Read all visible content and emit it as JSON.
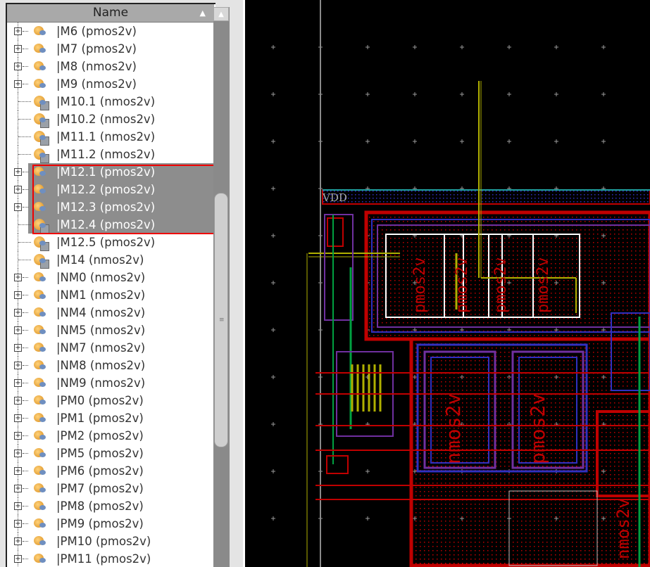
{
  "tree": {
    "column_header": "Name",
    "sort_indicator": "ascending",
    "rows": [
      {
        "label": "|M6 (pmos2v)",
        "expandable": true,
        "selected": false
      },
      {
        "label": "|M7 (pmos2v)",
        "expandable": true,
        "selected": false
      },
      {
        "label": "|M8 (nmos2v)",
        "expandable": true,
        "selected": false
      },
      {
        "label": "|M9 (nmos2v)",
        "expandable": true,
        "selected": false
      },
      {
        "label": "|M10.1 (nmos2v)",
        "expandable": false,
        "selected": false
      },
      {
        "label": "|M10.2 (nmos2v)",
        "expandable": false,
        "selected": false
      },
      {
        "label": "|M11.1 (nmos2v)",
        "expandable": false,
        "selected": false
      },
      {
        "label": "|M11.2 (nmos2v)",
        "expandable": false,
        "selected": false
      },
      {
        "label": "|M12.1 (pmos2v)",
        "expandable": true,
        "selected": true
      },
      {
        "label": "|M12.2 (pmos2v)",
        "expandable": true,
        "selected": true
      },
      {
        "label": "|M12.3 (pmos2v)",
        "expandable": true,
        "selected": true
      },
      {
        "label": "|M12.4 (pmos2v)",
        "expandable": false,
        "selected": true
      },
      {
        "label": "|M12.5 (pmos2v)",
        "expandable": false,
        "selected": false
      },
      {
        "label": "|M14 (nmos2v)",
        "expandable": false,
        "selected": false
      },
      {
        "label": "|NM0 (nmos2v)",
        "expandable": true,
        "selected": false
      },
      {
        "label": "|NM1 (nmos2v)",
        "expandable": true,
        "selected": false
      },
      {
        "label": "|NM4 (nmos2v)",
        "expandable": true,
        "selected": false
      },
      {
        "label": "|NM5 (nmos2v)",
        "expandable": true,
        "selected": false
      },
      {
        "label": "|NM7 (nmos2v)",
        "expandable": true,
        "selected": false
      },
      {
        "label": "|NM8 (nmos2v)",
        "expandable": true,
        "selected": false
      },
      {
        "label": "|NM9 (nmos2v)",
        "expandable": true,
        "selected": false
      },
      {
        "label": "|PM0 (pmos2v)",
        "expandable": true,
        "selected": false
      },
      {
        "label": "|PM1 (pmos2v)",
        "expandable": true,
        "selected": false
      },
      {
        "label": "|PM2 (pmos2v)",
        "expandable": true,
        "selected": false
      },
      {
        "label": "|PM5 (pmos2v)",
        "expandable": true,
        "selected": false
      },
      {
        "label": "|PM6 (pmos2v)",
        "expandable": true,
        "selected": false
      },
      {
        "label": "|PM7 (pmos2v)",
        "expandable": true,
        "selected": false
      },
      {
        "label": "|PM8 (pmos2v)",
        "expandable": true,
        "selected": false
      },
      {
        "label": "|PM9 (pmos2v)",
        "expandable": true,
        "selected": false
      },
      {
        "label": "|PM10 (pmos2v)",
        "expandable": true,
        "selected": false
      },
      {
        "label": "|PM11 (pmos2v)",
        "expandable": true,
        "selected": false
      }
    ],
    "highlight_color": "#e00000"
  },
  "layout": {
    "net_label": "VDD",
    "device_labels": [
      "pmos2v",
      "pmos2v",
      "pmos2v",
      "pmos2v",
      "nmos2v",
      "pmos2v",
      "nmos2v"
    ],
    "colors": {
      "background": "#000000",
      "metal1": "#3030c0",
      "poly": "#c00000",
      "metal2": "#b0b000",
      "nwell": "#7030a0",
      "selection": "#ffffff",
      "via": "#00a040"
    }
  }
}
